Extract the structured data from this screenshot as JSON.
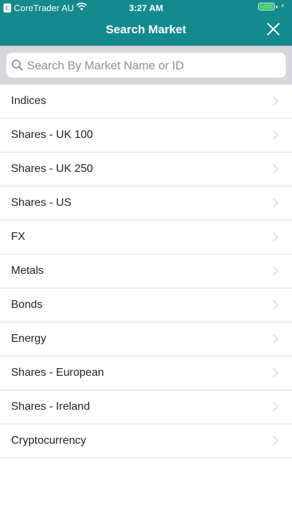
{
  "status_bar": {
    "back_app": "CoreTrader AU",
    "time": "3:27 AM",
    "battery_color": "#4cd964"
  },
  "header": {
    "title": "Search Market",
    "background": "#148a8c"
  },
  "search": {
    "placeholder": "Search By Market Name or ID",
    "value": ""
  },
  "categories": [
    {
      "label": "Indices"
    },
    {
      "label": "Shares - UK 100"
    },
    {
      "label": "Shares - UK 250"
    },
    {
      "label": "Shares - US"
    },
    {
      "label": "FX"
    },
    {
      "label": "Metals"
    },
    {
      "label": "Bonds"
    },
    {
      "label": "Energy"
    },
    {
      "label": "Shares - European"
    },
    {
      "label": "Shares - Ireland"
    },
    {
      "label": "Cryptocurrency"
    }
  ]
}
